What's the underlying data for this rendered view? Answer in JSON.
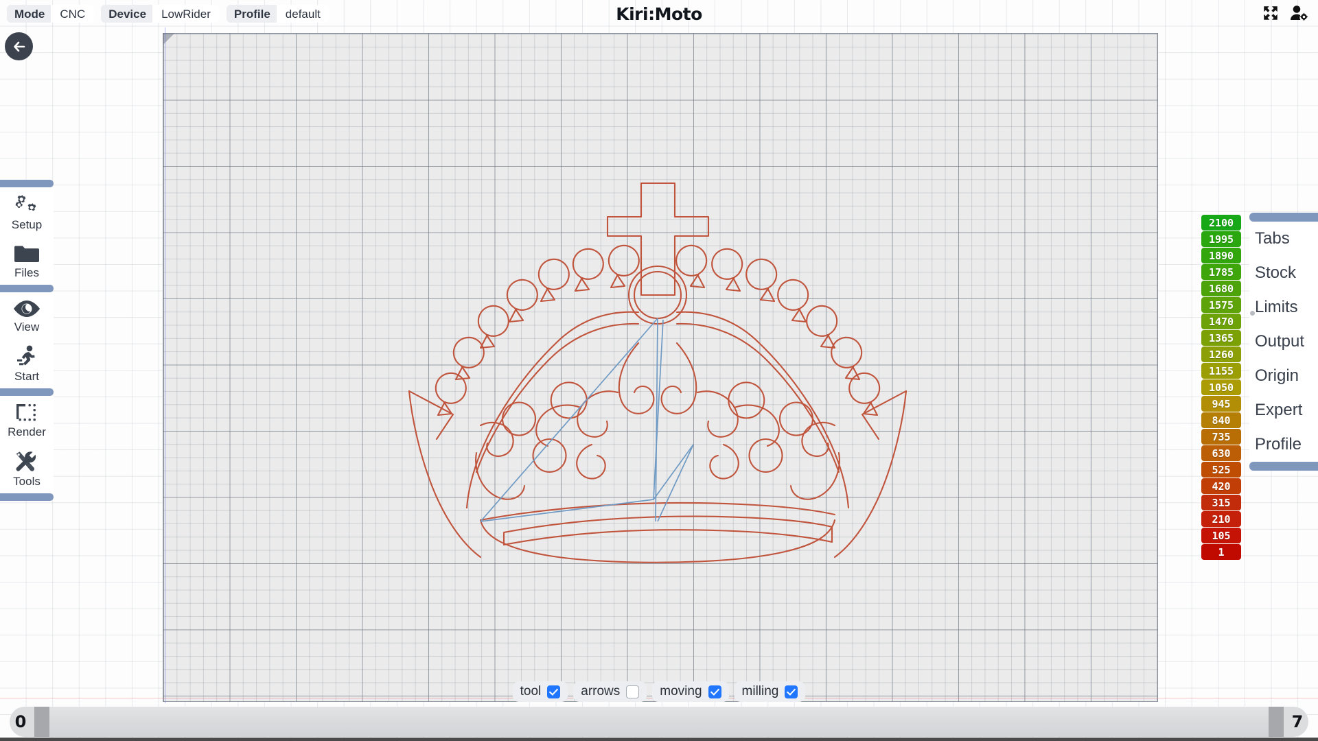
{
  "app": {
    "brand": "Kiri:Moto"
  },
  "topbar": {
    "chips": [
      {
        "key": "Mode",
        "value": "CNC",
        "name": "mode-chip"
      },
      {
        "key": "Device",
        "value": "LowRider",
        "name": "device-chip"
      },
      {
        "key": "Profile",
        "value": "default",
        "name": "profile-chip"
      }
    ],
    "icons": [
      {
        "name": "fullscreen-icon",
        "label": "fullscreen"
      },
      {
        "name": "user-settings-icon",
        "label": "user settings"
      }
    ]
  },
  "back_button": {
    "name": "back-icon",
    "label": "back"
  },
  "sidebar": {
    "groups": [
      {
        "items": [
          {
            "label": "Setup",
            "icon": "gears-icon"
          },
          {
            "label": "Files",
            "icon": "folder-icon"
          }
        ]
      },
      {
        "items": [
          {
            "label": "View",
            "icon": "eye-icon"
          },
          {
            "label": "Start",
            "icon": "runner-icon"
          }
        ]
      },
      {
        "items": [
          {
            "label": "Render",
            "icon": "render-icon"
          },
          {
            "label": "Tools",
            "icon": "tools-icon"
          }
        ]
      }
    ]
  },
  "right_panel": {
    "items": [
      {
        "label": "Tabs"
      },
      {
        "label": "Stock"
      },
      {
        "label": "Limits"
      },
      {
        "label": "Output"
      },
      {
        "label": "Origin"
      },
      {
        "label": "Expert"
      },
      {
        "label": "Profile"
      }
    ]
  },
  "color_scale": {
    "title": "speed legend",
    "rows": [
      {
        "value": "2100",
        "color": "#17a817"
      },
      {
        "value": "1995",
        "color": "#2aa70f"
      },
      {
        "value": "1890",
        "color": "#32a60d"
      },
      {
        "value": "1785",
        "color": "#3ea50b"
      },
      {
        "value": "1680",
        "color": "#4da40a"
      },
      {
        "value": "1575",
        "color": "#5da309"
      },
      {
        "value": "1470",
        "color": "#6da208"
      },
      {
        "value": "1365",
        "color": "#7ca107"
      },
      {
        "value": "1260",
        "color": "#8c9f06"
      },
      {
        "value": "1155",
        "color": "#9c9e06"
      },
      {
        "value": "1050",
        "color": "#ab9c05"
      },
      {
        "value": "945",
        "color": "#b18e05"
      },
      {
        "value": "840",
        "color": "#b57e05"
      },
      {
        "value": "735",
        "color": "#b96e05"
      },
      {
        "value": "630",
        "color": "#bc5e05"
      },
      {
        "value": "525",
        "color": "#bf4e04"
      },
      {
        "value": "420",
        "color": "#c23e07"
      },
      {
        "value": "315",
        "color": "#c32c0b"
      },
      {
        "value": "210",
        "color": "#c4200a"
      },
      {
        "value": "105",
        "color": "#c51406"
      },
      {
        "value": "1",
        "color": "#c00a00"
      }
    ]
  },
  "checkbar": {
    "items": [
      {
        "label": "tool",
        "checked": true
      },
      {
        "label": "arrows",
        "checked": false
      },
      {
        "label": "moving",
        "checked": true
      },
      {
        "label": "milling",
        "checked": true
      }
    ]
  },
  "slider": {
    "min_label": "0",
    "max_label": "7"
  },
  "viewport": {
    "model_name": "crown-toolpath",
    "cut_color": "#c0543c",
    "move_color": "#6f9ac4"
  }
}
